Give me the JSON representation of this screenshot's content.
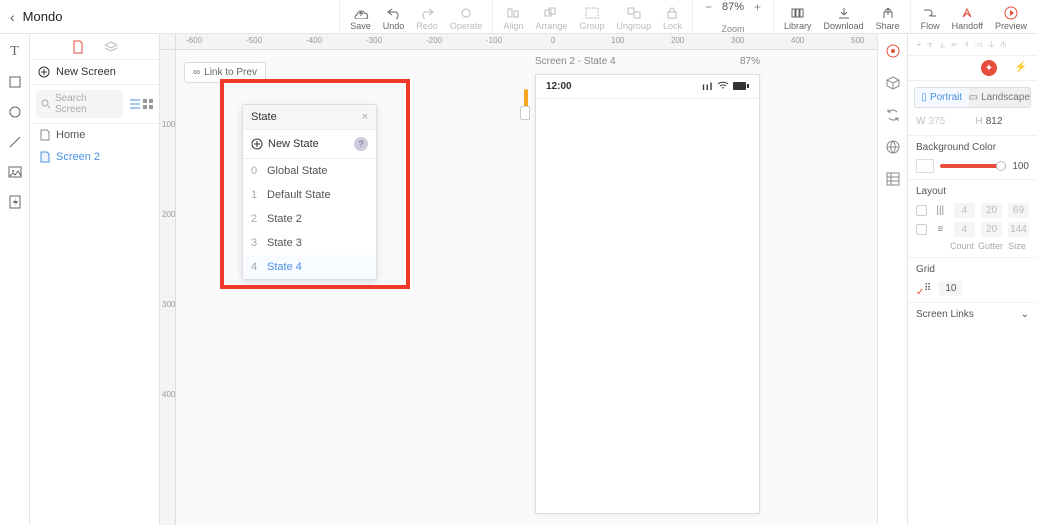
{
  "app_title": "Mondo",
  "toolbar": {
    "save": "Save",
    "undo": "Undo",
    "redo": "Redo",
    "operate": "Operate",
    "align": "Align",
    "arrange": "Arrange",
    "group": "Group",
    "ungroup": "Ungroup",
    "lock": "Lock",
    "zoom_label": "Zoom",
    "zoom_value": "87%",
    "library": "Library",
    "download": "Download",
    "share": "Share",
    "flow": "Flow",
    "handoff": "Handoff",
    "preview": "Preview"
  },
  "screens_panel": {
    "new_screen": "New Screen",
    "search_placeholder": "Search Screen",
    "items": [
      {
        "name": "Home",
        "selected": false
      },
      {
        "name": "Screen 2",
        "selected": true
      }
    ]
  },
  "canvas": {
    "link_prev": "Link to Prev",
    "ruler_h": [
      "-600",
      "-500",
      "-400",
      "-300",
      "-200",
      "-100",
      "0",
      "100",
      "200",
      "300",
      "400",
      "500"
    ],
    "ruler_v": [
      "100",
      "200",
      "300",
      "400"
    ],
    "artboard_title": "Screen 2 - State 4",
    "artboard_zoom": "87%",
    "statusbar_time": "12:00",
    "state_panel": {
      "title": "State",
      "new_state": "New State",
      "rows": [
        {
          "idx": "0",
          "name": "Global State",
          "active": false
        },
        {
          "idx": "1",
          "name": "Default State",
          "active": false
        },
        {
          "idx": "2",
          "name": "State 2",
          "active": false
        },
        {
          "idx": "3",
          "name": "State 3",
          "active": false
        },
        {
          "idx": "4",
          "name": "State 4",
          "active": true
        }
      ]
    }
  },
  "inspector": {
    "portrait": "Portrait",
    "landscape": "Landscape",
    "w_label": "W",
    "w_value": "375",
    "h_label": "H",
    "h_value": "812",
    "bg_title": "Background Color",
    "bg_value": "100",
    "layout_title": "Layout",
    "layout_cols": {
      "count": "4",
      "gutter": "20",
      "size": "69"
    },
    "layout_rows": {
      "count": "4",
      "gutter": "20",
      "size": "144"
    },
    "labels": {
      "count": "Count",
      "gutter": "Gutter",
      "size": "Size"
    },
    "grid_title": "Grid",
    "grid_value": "10",
    "links_title": "Screen Links"
  }
}
